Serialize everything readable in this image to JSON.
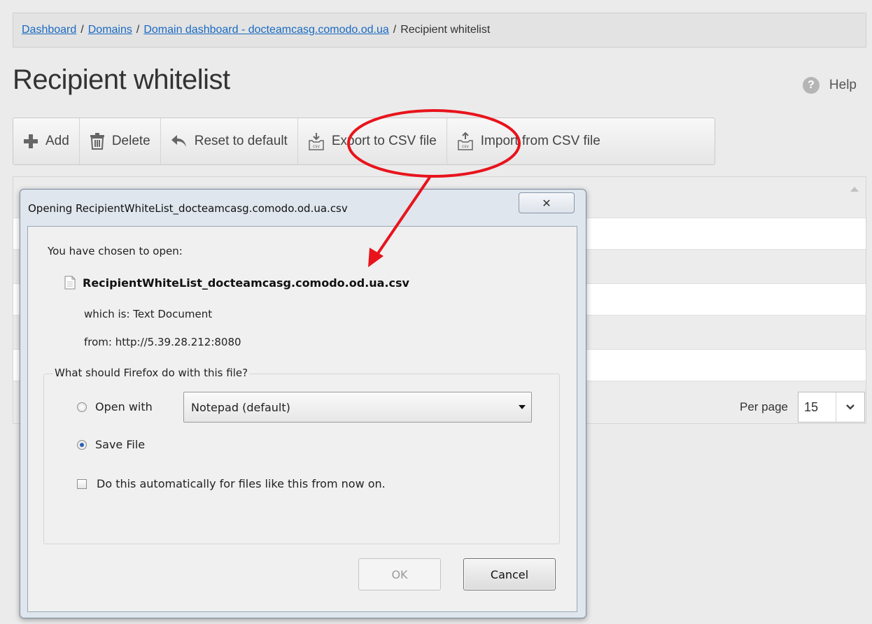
{
  "breadcrumb": {
    "dashboard": "Dashboard",
    "domains": "Domains",
    "domain_dashboard": "Domain dashboard - docteamcasg.comodo.od.ua",
    "current": "Recipient whitelist",
    "separator": "/"
  },
  "page": {
    "title": "Recipient whitelist",
    "help_label": "Help"
  },
  "toolbar": {
    "add": "Add",
    "delete": "Delete",
    "reset": "Reset to default",
    "export": "Export to CSV file",
    "import": "Import from CSV file"
  },
  "pager": {
    "per_page_label": "Per page",
    "per_page_value": "15"
  },
  "dialog": {
    "title": "Opening RecipientWhiteList_docteamcasg.comodo.od.ua.csv",
    "close_glyph": "✕",
    "chosen_text": "You have chosen to open:",
    "file_name": "RecipientWhiteList_docteamcasg.comodo.od.ua.csv",
    "which_is": "which is:  Text Document",
    "from": "from:  http://5.39.28.212:8080",
    "question": "What should Firefox do with this file?",
    "open_with_label": "Open with",
    "open_with_app": "Notepad (default)",
    "save_file_label": "Save File",
    "auto_label": "Do this automatically for files like this from now on.",
    "ok": "OK",
    "cancel": "Cancel"
  },
  "colors": {
    "link": "#1a6ac2",
    "annotation": "#e8141c"
  }
}
